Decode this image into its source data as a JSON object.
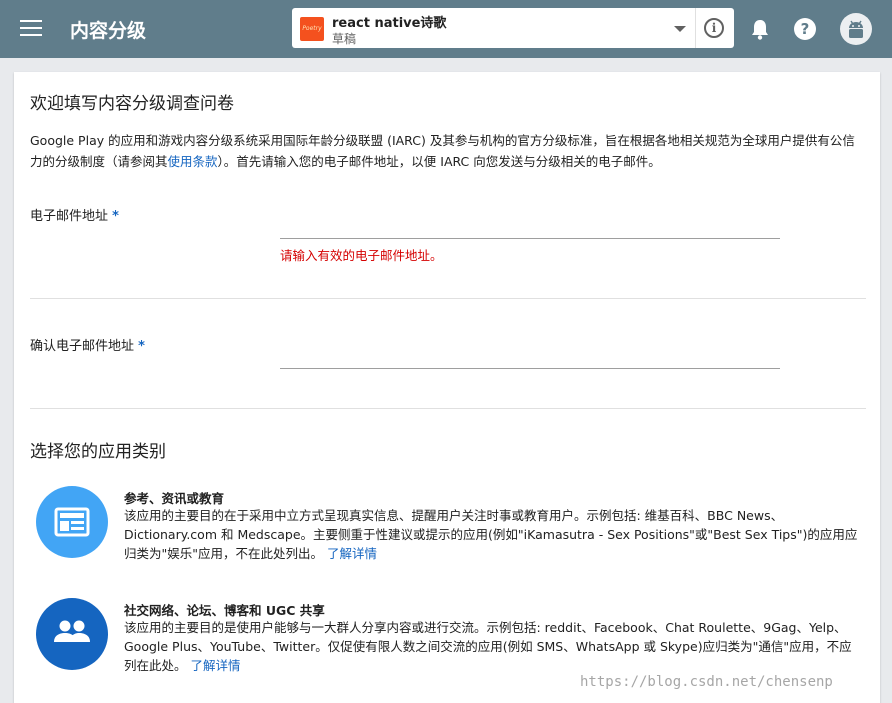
{
  "header": {
    "title": "内容分级",
    "app": {
      "name": "react native诗歌",
      "status": "草稿",
      "thumb_text": "Poetry"
    },
    "icons": [
      "menu-icon",
      "dropdown-icon",
      "info-icon",
      "bell-icon",
      "help-icon",
      "android-avatar-icon"
    ]
  },
  "questionnaire": {
    "title": "欢迎填写内容分级调查问卷",
    "intro_pre": "Google Play 的应用和游戏内容分级系统采用国际年龄分级联盟 (IARC) 及其参与机构的官方分级标准，旨在根据各地相关规范为全球用户提供有公信力的分级制度（请参阅其",
    "intro_link": "使用条款",
    "intro_post": "）。首先请输入您的电子邮件地址，以便 IARC 向您发送与分级相关的电子邮件。",
    "email_label": "电子邮件地址",
    "required_mark": "*",
    "email_value": "",
    "email_error": "请输入有效的电子邮件地址。",
    "confirm_label": "确认电子邮件地址",
    "confirm_value": ""
  },
  "category_section": {
    "title": "选择您的应用类别",
    "items": [
      {
        "icon": "newspaper-icon",
        "title": "参考、资讯或教育",
        "description": "该应用的主要目的在于采用中立方式呈现真实信息、提醒用户关注时事或教育用户。示例包括: 维基百科、BBC News、Dictionary.com 和 Medscape。主要侧重于性建议或提示的应用(例如\"iKamasutra - Sex Positions\"或\"Best Sex Tips\")的应用应归类为\"娱乐\"应用，不在此处列出。",
        "link": "了解详情"
      },
      {
        "icon": "people-icon",
        "title": "社交网络、论坛、博客和 UGC 共享",
        "description": "该应用的主要目的是使用户能够与一大群人分享内容或进行交流。示例包括: reddit、Facebook、Chat Roulette、9Gag、Yelp、Google Plus、YouTube、Twitter。仅促使有限人数之间交流的应用(例如 SMS、WhatsApp 或 Skype)应归类为\"通信\"应用，不应列在此处。",
        "link": "了解详情"
      }
    ]
  },
  "watermark": "https://blog.csdn.net/chensenp",
  "colors": {
    "header": "#607d8b",
    "link": "#1565c0",
    "error": "#d50000",
    "cat1_icon": "#42a5f5",
    "cat2_icon": "#1565c0"
  }
}
